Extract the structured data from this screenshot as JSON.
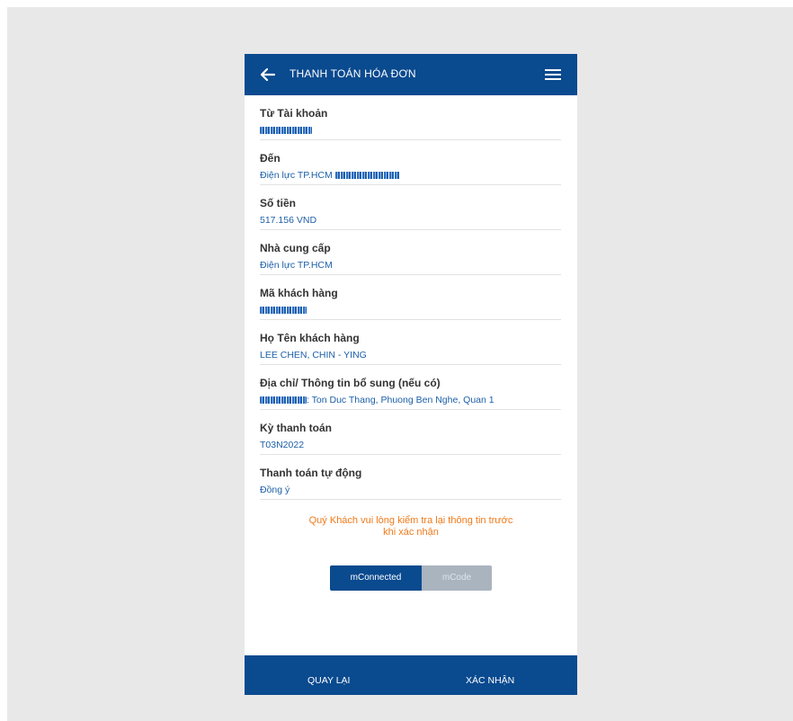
{
  "header": {
    "title": "THANH TOÁN HÓA ĐƠN"
  },
  "fields": [
    {
      "label": "Từ Tài khoản",
      "value": "",
      "masked": true
    },
    {
      "label": "Đến",
      "value": "Điện lực TP.HCM",
      "masked": true
    },
    {
      "label": "Số tiền",
      "value": "517.156 VND",
      "masked": false
    },
    {
      "label": "Nhà cung cấp",
      "value": "Điện lực TP.HCM",
      "masked": false
    },
    {
      "label": "Mã khách hàng",
      "value": "",
      "masked": true
    },
    {
      "label": "Họ Tên khách hàng",
      "value": "LEE CHEN, CHIN - YING",
      "masked": false
    },
    {
      "label": "Địa chỉ/ Thông tin bổ sung (nếu có)",
      "value": ": Ton Duc Thang, Phuong Ben Nghe, Quan 1",
      "masked": true
    },
    {
      "label": "Kỳ thanh toán",
      "value": "T03N2022",
      "masked": false
    },
    {
      "label": "Thanh toán tự động",
      "value": "Đồng ý",
      "masked": false
    }
  ],
  "notice": {
    "line1": "Quý Khách vui lòng kiểm tra lại thông tin trước",
    "line2": "khi xác nhận"
  },
  "auth_toggle": {
    "active": "mConnected",
    "inactive": "mCode"
  },
  "footer": {
    "back_label": "QUAY LẠI",
    "confirm_label": "XÁC NHẬN"
  },
  "colors": {
    "primary": "#0a4a8f",
    "value_text": "#1c5fa8",
    "notice": "#f07a1a",
    "toggle_inactive": "#a9b4bf",
    "background": "#e8e8e8"
  }
}
